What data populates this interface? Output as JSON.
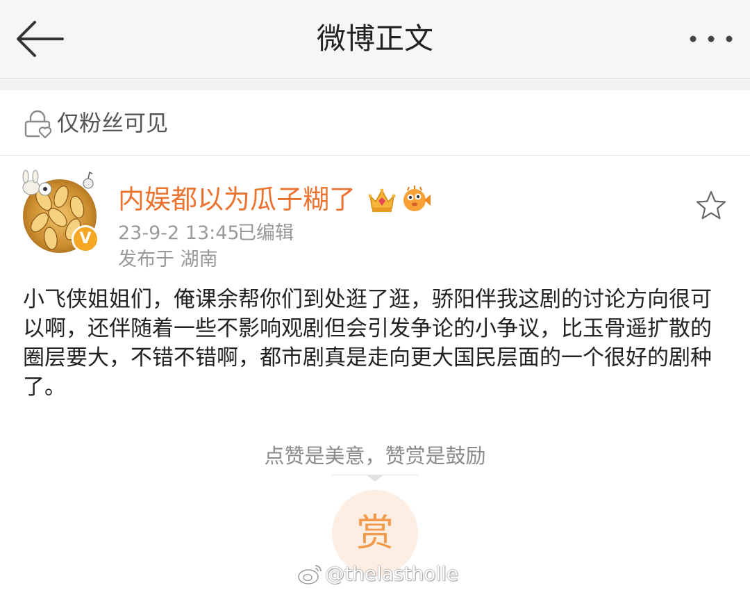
{
  "nav": {
    "title": "微博正文",
    "back_icon": "back-arrow-icon",
    "more_icon": "more-dots-icon"
  },
  "visibility": {
    "label": "仅粉丝可见",
    "icon": "lock-heart-icon"
  },
  "post": {
    "author": "内娱都以为瓜子糊了",
    "verified_badge": "V",
    "time": "23-9-2 13:45",
    "edited": "已编辑",
    "location": "发布于 湖南",
    "text": "小飞侠姐姐们，俺课余帮你们到处逛了逛，骄阳伴我这剧的讨论方向很可以啊，还伴随着一些不影响观剧但会引发争论的小争议，比玉骨遥扩散的圈层要大，不错不错啊，都市剧真是走向更大国民层面的一个很好的剧种了。"
  },
  "reward": {
    "hint": "点赞是美意，赞赏是鼓励",
    "button_label": "赏"
  },
  "watermark": {
    "text": "@thelastholle"
  },
  "colors": {
    "username": "#eb7330",
    "reward_bg": "#fdeee4",
    "reward_fg": "#f39a4a",
    "badge": "#f5a623"
  }
}
